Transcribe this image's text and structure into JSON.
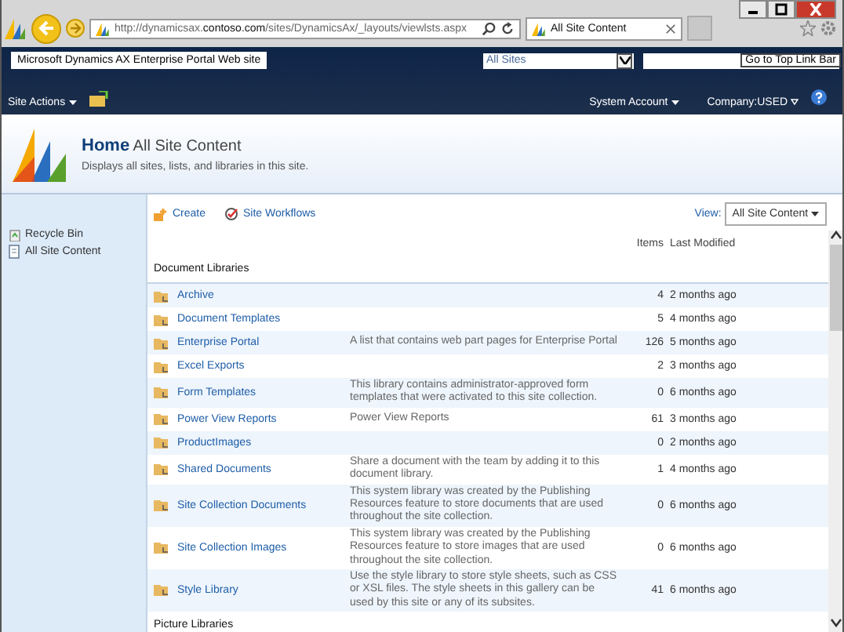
{
  "browser": {
    "address_plain_start": "http://dynamicsax.",
    "address_domain": "contoso.com",
    "address_plain_end": "/sites/DynamicsAx/_layouts/viewlsts.aspx",
    "tab_title": "All Site Content"
  },
  "ribbon": {
    "site_title": "Microsoft Dynamics AX Enterprise Portal Web site",
    "scope": "All Sites",
    "tooltip": "Go to Top Link Bar",
    "site_actions": "Site Actions",
    "account": "System Account",
    "company": "Company:USED"
  },
  "header": {
    "title": "Home",
    "subtitle": "All Site Content",
    "description": "Displays all sites, lists, and libraries in this site."
  },
  "sidebar": {
    "items": [
      {
        "label": "Recycle Bin",
        "kind": "bin"
      },
      {
        "label": "All Site Content",
        "kind": "page"
      }
    ]
  },
  "toolbar": {
    "create": "Create",
    "workflows": "Site Workflows",
    "view_label": "View:",
    "view_value": "All Site Content"
  },
  "table": {
    "columns": [
      "Items",
      "Last Modified"
    ],
    "sections": [
      {
        "title": "Document Libraries",
        "rows": [
          {
            "name": "Archive",
            "items": "4",
            "modified": "2 months ago"
          },
          {
            "name": "Document Templates",
            "items": "5",
            "modified": "4 months ago"
          },
          {
            "name": "Enterprise Portal",
            "description": "A list that contains web part pages for Enterprise Portal",
            "items": "126",
            "modified": "5 months ago"
          },
          {
            "name": "Excel Exports",
            "items": "2",
            "modified": "3 months ago"
          },
          {
            "name": "Form Templates",
            "description": "This library contains administrator-approved form templates that were activated to this site collection.",
            "items": "0",
            "modified": "6 months ago"
          },
          {
            "name": "Power View Reports",
            "description": "Power View Reports",
            "items": "61",
            "modified": "3 months ago"
          },
          {
            "name": "ProductImages",
            "items": "0",
            "modified": "2 months ago"
          },
          {
            "name": "Shared Documents",
            "description": "Share a document with the team by adding it to this document library.",
            "items": "1",
            "modified": "4 months ago"
          },
          {
            "name": "Site Collection Documents",
            "description": "This system library was created by the Publishing Resources feature to store documents that are used throughout the site collection.",
            "items": "0",
            "modified": "6 months ago"
          },
          {
            "name": "Site Collection Images",
            "description": "This system library was created by the Publishing Resources feature to store images that are used throughout the site collection.",
            "items": "0",
            "modified": "6 months ago"
          },
          {
            "name": "Style Library",
            "description": "Use the style library to store style sheets, such as CSS or XSL files. The style sheets in this gallery can be used by this site or any of its subsites.",
            "items": "41",
            "modified": "6 months ago"
          }
        ]
      },
      {
        "title": "Picture Libraries"
      }
    ]
  }
}
